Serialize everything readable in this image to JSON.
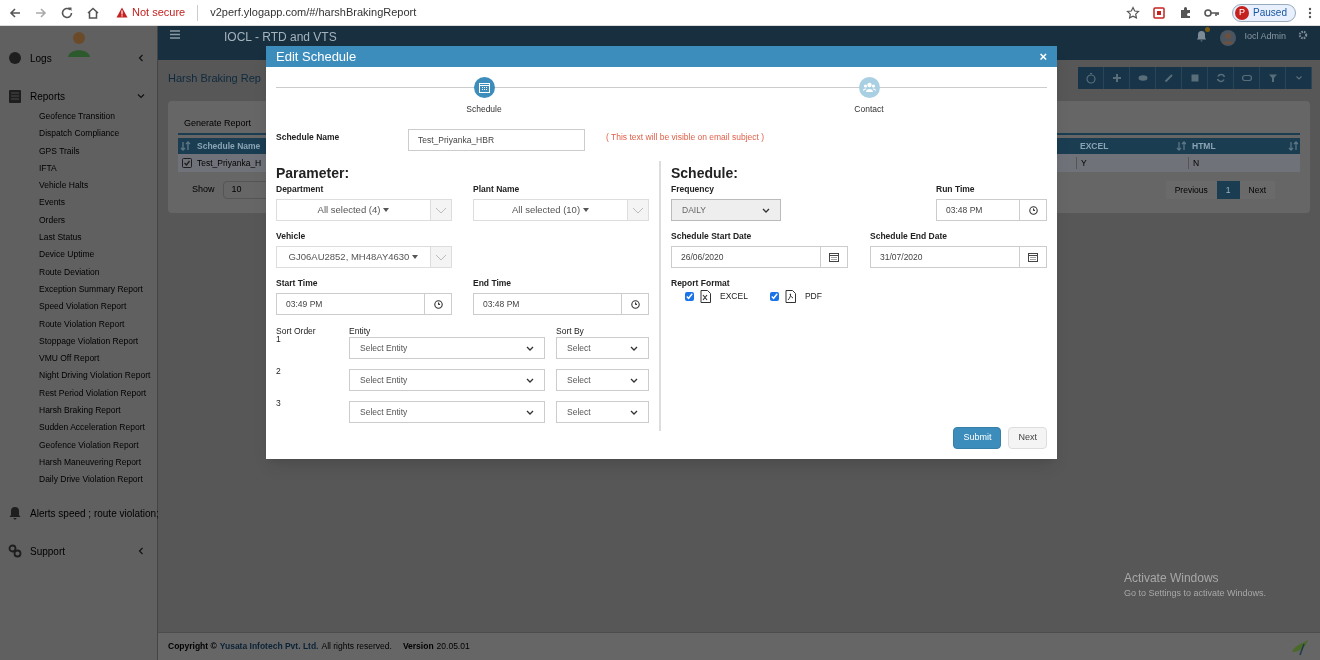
{
  "browser": {
    "security_label": "Not secure",
    "url": "v2perf.ylogapp.com/#/harshBrakingReport",
    "profile_initial": "P",
    "profile_status": "Paused"
  },
  "header": {
    "title": "IOCL - RTD and VTS",
    "user_name": "Iocl Admin"
  },
  "sidebar": {
    "items": [
      {
        "label": "Logs",
        "kind": "logs",
        "expanded": false
      },
      {
        "label": "Reports",
        "kind": "reports",
        "expanded": true,
        "children": [
          {
            "label": "Geofence Transition"
          },
          {
            "label": "Dispatch Compliance"
          },
          {
            "label": "GPS Trails"
          },
          {
            "label": "IFTA"
          },
          {
            "label": "Vehicle Halts"
          },
          {
            "label": "Events"
          },
          {
            "label": "Orders"
          },
          {
            "label": "Last Status"
          },
          {
            "label": "Device Uptime"
          },
          {
            "label": "Route Deviation"
          },
          {
            "label": "Exception Summary Report"
          },
          {
            "label": "Speed Violation Report"
          },
          {
            "label": "Route Violation Report"
          },
          {
            "label": "Stoppage Violation Report"
          },
          {
            "label": "VMU Off Report"
          },
          {
            "label": "Night Driving Violation Report"
          },
          {
            "label": "Rest Period Violation Report"
          },
          {
            "label": "Harsh Braking Report"
          },
          {
            "label": "Sudden Acceleration Report"
          },
          {
            "label": "Geofence Violation Report"
          },
          {
            "label": "Harsh Maneuvering Report"
          },
          {
            "label": "Daily Drive Violation Report"
          }
        ]
      },
      {
        "label": "Alerts speed ; route violation;",
        "kind": "alerts"
      },
      {
        "label": "Support",
        "kind": "support",
        "expanded": false
      }
    ]
  },
  "page": {
    "title": "Harsh Braking Rep",
    "tab": "Generate Report",
    "table": {
      "columns": [
        "Schedule Name",
        "EXCEL",
        "HTML"
      ],
      "rows": [
        {
          "checked": true,
          "cells": [
            "Test_Priyanka_H",
            "Y",
            "N"
          ]
        }
      ]
    },
    "show_label": "Show",
    "page_size": "10",
    "pagination": [
      {
        "label": "Previous",
        "selected": false
      },
      {
        "label": "1",
        "selected": true
      },
      {
        "label": "Next",
        "selected": false
      }
    ]
  },
  "footer": {
    "copyright": "Copyright ©",
    "company": "Yusata Infotech Pvt. Ltd.",
    "rights": "All rights reserved.",
    "version_label": "Version",
    "version": "20.05.01"
  },
  "os_notice": {
    "title": "Activate Windows",
    "subtitle": "Go to Settings to activate Windows."
  },
  "modal": {
    "title": "Edit Schedule",
    "close": "×",
    "steps": [
      {
        "label": "Schedule",
        "selected": true
      },
      {
        "label": "Contact",
        "selected": false
      }
    ],
    "schedule_name": {
      "label": "Schedule Name",
      "value": "Test_Priyanka_HBR",
      "note": "( This text will be visible on email subject )"
    },
    "parameter": {
      "heading": "Parameter:",
      "department": {
        "label": "Department",
        "value": "All selected (4)"
      },
      "plant_name": {
        "label": "Plant Name",
        "value": "All selected (10)"
      },
      "vehicle": {
        "label": "Vehicle",
        "value": "GJ06AU2852, MH48AY4630"
      },
      "start_time": {
        "label": "Start Time",
        "value": "03:49 PM"
      },
      "end_time": {
        "label": "End Time",
        "value": "03:48 PM"
      },
      "sort": {
        "label": "Sort Order",
        "entity_label": "Entity",
        "sort_by_label": "Sort By",
        "rows": [
          {
            "index": "1",
            "entity": "Select Entity",
            "sort_by": "Select"
          },
          {
            "index": "2",
            "entity": "Select Entity",
            "sort_by": "Select"
          },
          {
            "index": "3",
            "entity": "Select Entity",
            "sort_by": "Select"
          }
        ]
      }
    },
    "schedule": {
      "heading": "Schedule:",
      "frequency": {
        "label": "Frequency",
        "value": "DAILY",
        "disabled": true
      },
      "run_time": {
        "label": "Run Time",
        "value": "03:48 PM"
      },
      "start_date": {
        "label": "Schedule Start Date",
        "value": "26/06/2020"
      },
      "end_date": {
        "label": "Schedule End Date",
        "value": "31/07/2020"
      },
      "report_format": {
        "label": "Report Format",
        "options": [
          {
            "label": "EXCEL",
            "kind": "excel",
            "checked": true
          },
          {
            "label": "PDF",
            "kind": "pdf",
            "checked": true
          }
        ]
      }
    },
    "buttons": [
      {
        "label": "Submit",
        "kind": "primary"
      },
      {
        "label": "Next",
        "kind": "secondary"
      }
    ]
  }
}
